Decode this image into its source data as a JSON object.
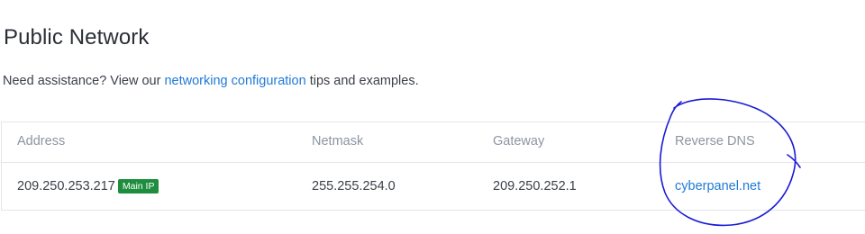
{
  "section": {
    "title": "Public Network",
    "help_prefix": "Need assistance? View our ",
    "help_link": "networking configuration",
    "help_suffix": " tips and examples."
  },
  "table": {
    "columns": [
      "Address",
      "Netmask",
      "Gateway",
      "Reverse DNS"
    ],
    "rows": [
      {
        "address": "209.250.253.217",
        "badge": "Main IP",
        "netmask": "255.255.254.0",
        "gateway": "209.250.252.1",
        "reverse_dns": "cyberpanel.net"
      }
    ]
  },
  "colors": {
    "link": "#1f7ad8",
    "badge_bg": "#1e8e3e",
    "annotation": "#1a1ad6"
  }
}
